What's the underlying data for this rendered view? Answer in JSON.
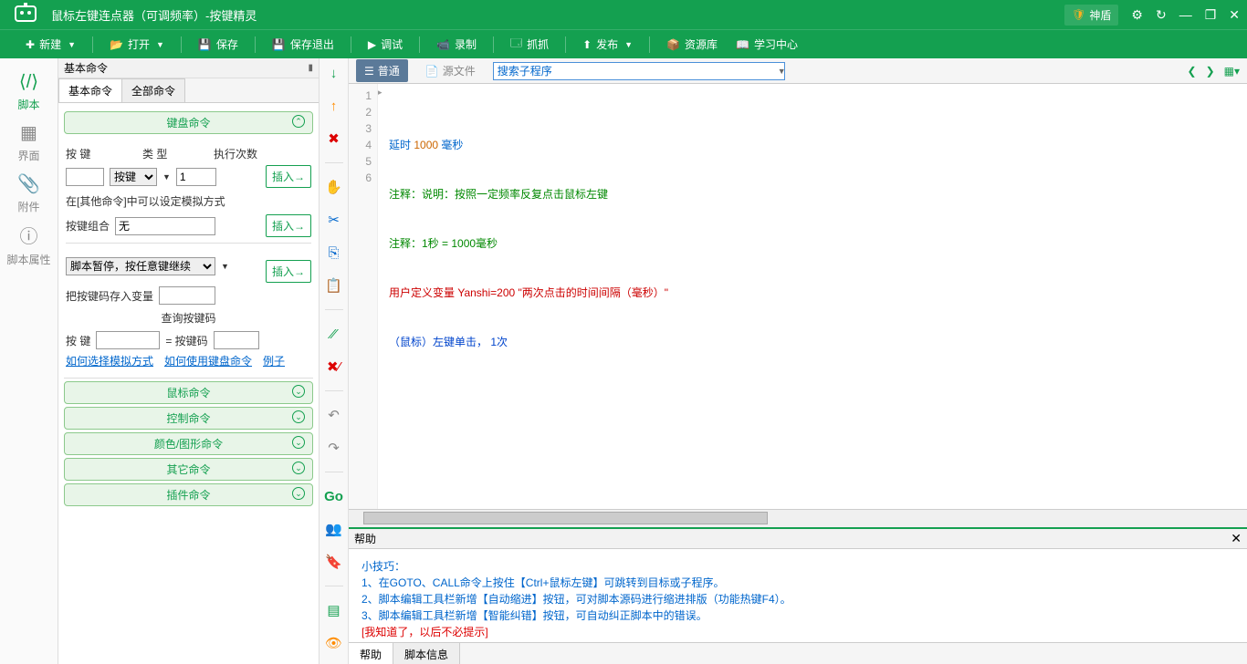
{
  "title": "鼠标左键连点器（可调频率）-按键精灵",
  "shield": "神盾",
  "menu": {
    "new": "新建",
    "open": "打开",
    "save": "保存",
    "saveexit": "保存退出",
    "debug": "调试",
    "record": "录制",
    "grab": "抓抓",
    "publish": "发布",
    "resource": "资源库",
    "learn": "学习中心"
  },
  "leftnav": {
    "script": "脚本",
    "ui": "界面",
    "attach": "附件",
    "props": "脚本属性"
  },
  "panel_title": "基本命令",
  "tabs": {
    "basic": "基本命令",
    "all": "全部命令"
  },
  "sections": {
    "keyboard": "键盘命令",
    "mouse": "鼠标命令",
    "control": "控制命令",
    "color": "颜色/图形命令",
    "other": "其它命令",
    "plugin": "插件命令"
  },
  "kb": {
    "keylbl": "按 键",
    "typelbl": "类 型",
    "countlbl": "执行次数",
    "typesel": "按键",
    "count": "1",
    "note": "在[其他命令]中可以设定模拟方式",
    "combolbl": "按键组合",
    "combo": "无",
    "pause": "脚本暂停，按任意键继续",
    "savecode": "把按键码存入变量",
    "querylbl": "查询按键码",
    "qkeylbl": "按 键",
    "qeq": "= 按键码",
    "link1": "如何选择模拟方式",
    "link2": "如何使用键盘命令",
    "link3": "例子",
    "insert": "插入→"
  },
  "editbar": {
    "normal": "普通",
    "source": "源文件",
    "search": "搜索子程序"
  },
  "code": {
    "l1a": "延时 ",
    "l1b": "1000 ",
    "l1c": "毫秒",
    "l2": "注释：说明：按照一定频率反复点击鼠标左键",
    "l3": "注释：1秒 = 1000毫秒",
    "l4a": "用户定义变量 ",
    "l4b": "Yanshi=200 \"两次点击的时间间隔（毫秒）\"",
    "l5": "（鼠标）左键单击， 1次"
  },
  "help": {
    "title": "帮助",
    "h1": "小技巧：",
    "t1": "1、在GOTO、CALL命令上按住【Ctrl+鼠标左键】可跳转到目标或子程序。",
    "t2": "2、脚本编辑工具栏新增【自动缩进】按钮，可对脚本源码进行缩进排版（功能热键F4）。",
    "t3": "3、脚本编辑工具栏新增【智能纠错】按钮，可自动纠正脚本中的错误。",
    "dismiss": "[我知道了，以后不必提示]",
    "tab1": "帮助",
    "tab2": "脚本信息"
  }
}
